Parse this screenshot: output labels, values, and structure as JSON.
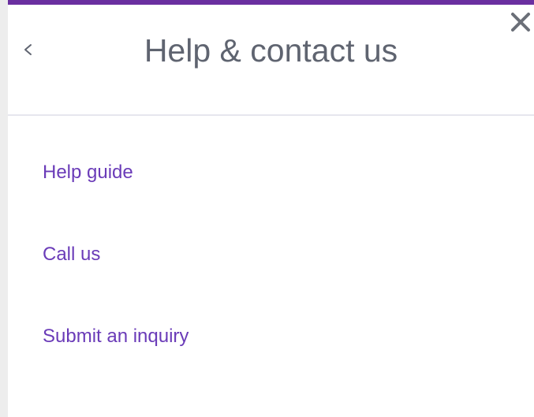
{
  "header": {
    "title": "Help & contact us"
  },
  "icons": {
    "back": "chevron-left-icon",
    "close": "close-icon"
  },
  "menu": {
    "items": [
      {
        "label": "Help guide"
      },
      {
        "label": "Call us"
      },
      {
        "label": "Submit an inquiry"
      }
    ]
  },
  "colors": {
    "accent": "#6a2fa0",
    "link": "#6a3bb8",
    "title": "#5f6470",
    "divider": "#e6e6ee"
  }
}
